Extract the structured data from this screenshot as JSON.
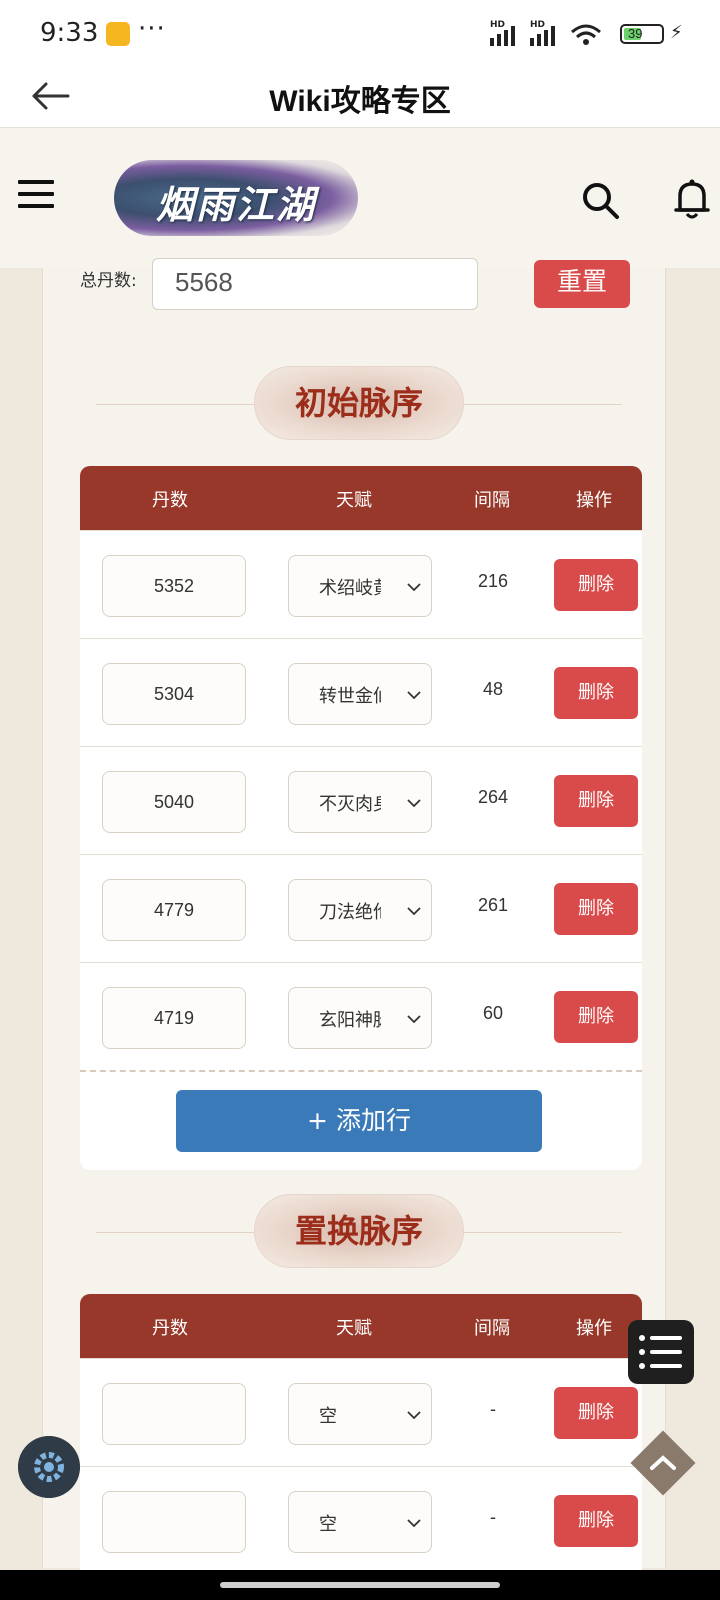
{
  "status": {
    "time": "9:33",
    "dots": "···",
    "battery": "39"
  },
  "nav": {
    "title": "Wiki攻略专区"
  },
  "site": {
    "logo_text": "烟雨江湖"
  },
  "total": {
    "label": "总丹数:",
    "value": "5568",
    "reset_label": "重置"
  },
  "section1": {
    "title": "初始脉序",
    "headers": {
      "dan": "丹数",
      "talent": "天赋",
      "gap": "间隔",
      "action": "操作"
    },
    "rows": [
      {
        "dan": "5352",
        "talent": "术绍岐黄",
        "gap": "216",
        "delete": "删除"
      },
      {
        "dan": "5304",
        "talent": "转世金仙",
        "gap": "48",
        "delete": "删除"
      },
      {
        "dan": "5040",
        "talent": "不灭肉身",
        "gap": "264",
        "delete": "删除"
      },
      {
        "dan": "4779",
        "talent": "刀法绝伦",
        "gap": "261",
        "delete": "删除"
      },
      {
        "dan": "4719",
        "talent": "玄阳神脉",
        "gap": "60",
        "delete": "删除"
      }
    ],
    "add_label": "+ 添加行"
  },
  "section2": {
    "title": "置换脉序",
    "headers": {
      "dan": "丹数",
      "talent": "天赋",
      "gap": "间隔",
      "action": "操作"
    },
    "rows": [
      {
        "dan": "",
        "talent": "空",
        "gap": "-",
        "delete": "删除"
      },
      {
        "dan": "",
        "talent": "空",
        "gap": "-",
        "delete": "删除"
      }
    ]
  },
  "colors": {
    "header_bg": "#97382a",
    "danger": "#d94b4b",
    "primary": "#3a7ab8",
    "title_red": "#9c2d1a"
  }
}
